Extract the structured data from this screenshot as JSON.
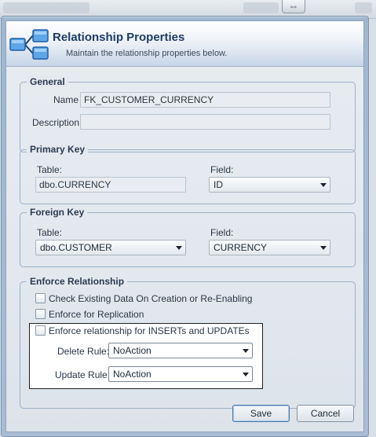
{
  "background": {
    "grip_glyph": "⇔"
  },
  "header": {
    "title": "Relationship Properties",
    "subtitle": "Maintain the relationship properties below.",
    "icon": "relationship-tables-icon"
  },
  "general": {
    "title": "General",
    "name_label": "Name",
    "name_value": "FK_CUSTOMER_CURRENCY",
    "description_label": "Description",
    "description_value": ""
  },
  "primary_key": {
    "title": "Primary Key",
    "table_label": "Table:",
    "table_value": "dbo.CURRENCY",
    "field_label": "Field:",
    "field_value": "ID"
  },
  "foreign_key": {
    "title": "Foreign Key",
    "table_label": "Table:",
    "table_value": "dbo.CUSTOMER",
    "field_label": "Field:",
    "field_value": "CURRENCY"
  },
  "enforce": {
    "title": "Enforce Relationship",
    "check_existing": {
      "label": "Check Existing Data On Creation or Re-Enabling",
      "checked": false
    },
    "replication": {
      "label": "Enforce for Replication",
      "checked": false
    },
    "inserts_updates": {
      "label": "Enforce relationship for INSERTs and UPDATEs",
      "checked": false
    },
    "delete_rule_label": "Delete Rule:",
    "delete_rule_value": "NoAction",
    "update_rule_label": "Update Rule:",
    "update_rule_value": "NoAction"
  },
  "buttons": {
    "save": "Save",
    "cancel": "Cancel"
  },
  "colors": {
    "accent": "#1e3c64",
    "group_border": "#9bb0c8"
  }
}
